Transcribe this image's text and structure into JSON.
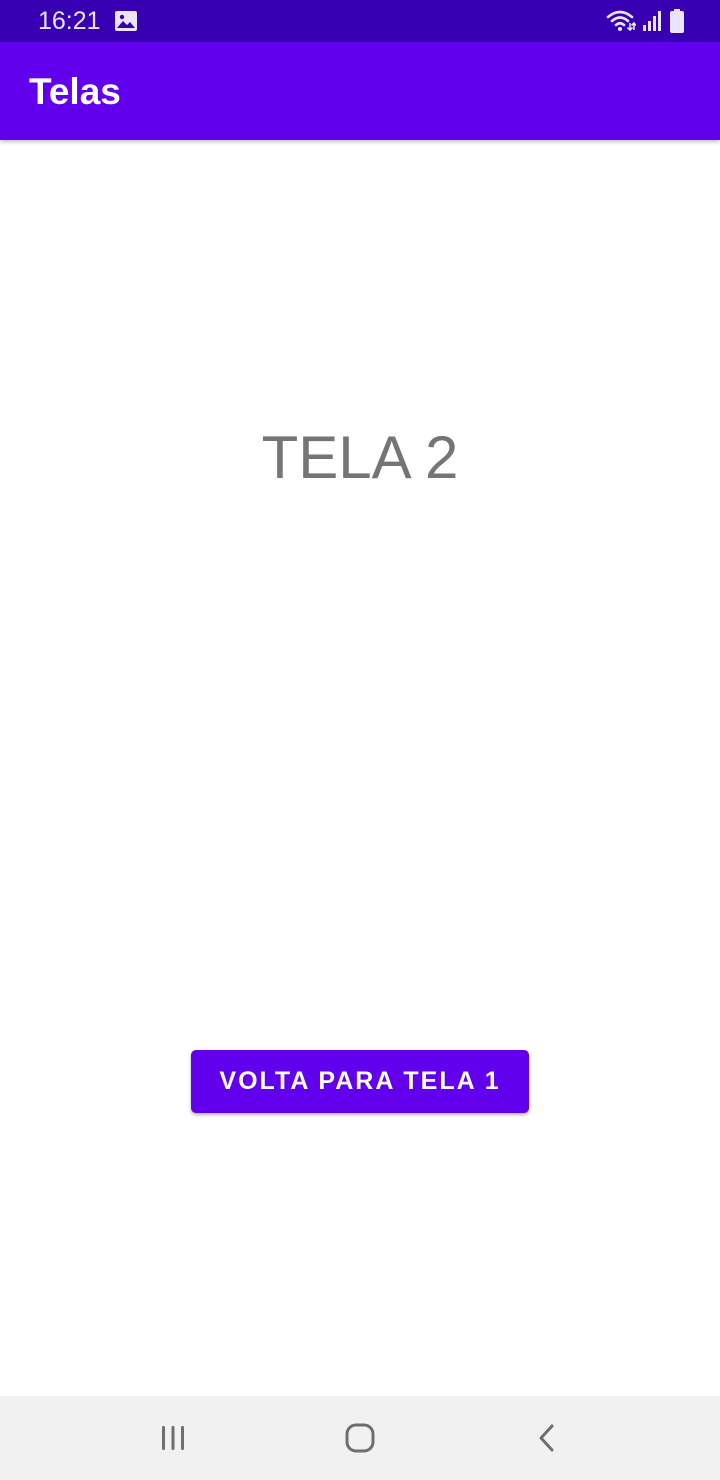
{
  "status_bar": {
    "time": "16:21",
    "icons": [
      "gallery-icon",
      "wifi-icon",
      "signal-icon",
      "battery-icon"
    ],
    "background_color": "#3700b3"
  },
  "app_bar": {
    "title": "Telas",
    "background_color": "#6200ee"
  },
  "main": {
    "screen_label": "TELA 2",
    "back_button_label": "VOLTA PARA TELA 1"
  },
  "nav_bar": {
    "icons": [
      "recent-apps-icon",
      "home-icon",
      "back-icon"
    ]
  }
}
